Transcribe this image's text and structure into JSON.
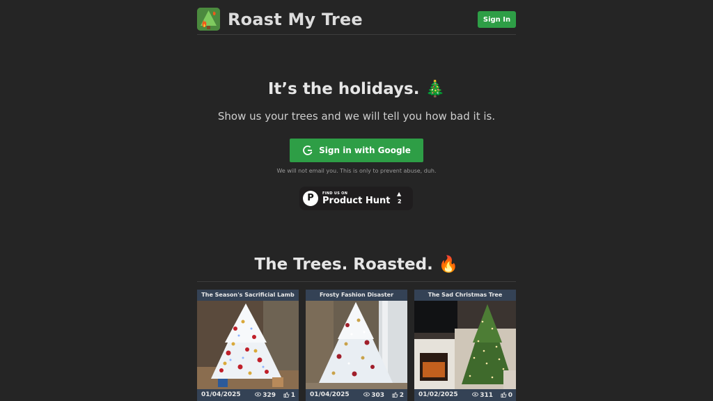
{
  "header": {
    "brand": "Roast My Tree",
    "sign_in_label": "Sign In"
  },
  "hero": {
    "title": "It’s the holidays. 🎄",
    "subtitle": "Show us your trees and we will tell you how bad it is.",
    "google_button_label": "Sign in with Google",
    "disclaimer": "We will not email you. This is only to prevent abuse, duh."
  },
  "product_hunt": {
    "small_text": "FIND US ON",
    "big_text": "Product Hunt",
    "logo_letter": "P",
    "arrow": "▲",
    "upvotes": "2"
  },
  "section": {
    "title": "The Trees. Roasted. 🔥"
  },
  "cards": [
    {
      "title": "The Season's Sacrificial Lamb",
      "date": "01/04/2025",
      "views": "329",
      "likes": "1"
    },
    {
      "title": "Frosty Fashion Disaster",
      "date": "01/04/2025",
      "views": "303",
      "likes": "2"
    },
    {
      "title": "The Sad Christmas Tree",
      "date": "01/02/2025",
      "views": "311",
      "likes": "0"
    }
  ],
  "colors": {
    "background": "#252525",
    "accent_green": "#2e9e46",
    "card_bar": "#344255"
  },
  "icons": [
    "tree-fire-logo-icon",
    "google-icon",
    "product-hunt-icon",
    "eye-icon",
    "thumbs-up-icon"
  ]
}
